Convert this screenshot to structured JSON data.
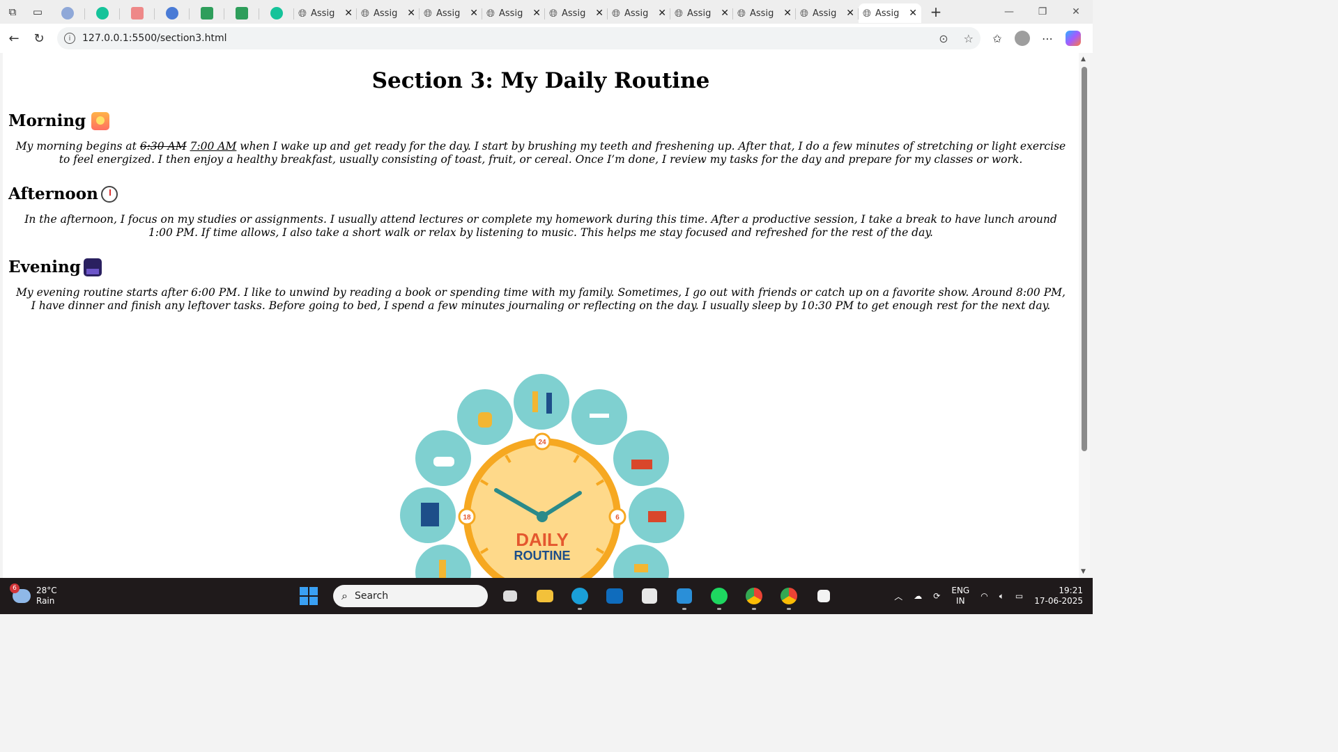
{
  "browser": {
    "tabs": [
      {
        "label": "Assig"
      },
      {
        "label": "Assig"
      },
      {
        "label": "Assig"
      },
      {
        "label": "Assig"
      },
      {
        "label": "Assig"
      },
      {
        "label": "Assig"
      },
      {
        "label": "Assig"
      },
      {
        "label": "Assig"
      },
      {
        "label": "Assig"
      },
      {
        "label": "Assig"
      }
    ],
    "url": "127.0.0.1:5500/section3.html"
  },
  "page": {
    "title": "Section 3: My Daily Routine",
    "morning": {
      "heading": "Morning",
      "text_before": "My morning begins at ",
      "old_time": "6:30 AM",
      "new_time": "7:00 AM",
      "text_after": " when I wake up and get ready for the day. I start by brushing my teeth and freshening up. After that, I do a few minutes of stretching or light exercise to feel energized. I then enjoy a healthy breakfast, usually consisting of toast, fruit, or cereal. Once I’m done, I review my tasks for the day and prepare for my classes or work."
    },
    "afternoon": {
      "heading": "Afternoon",
      "text": "In the afternoon, I focus on my studies or assignments. I usually attend lectures or complete my homework during this time. After a productive session, I take a break to have lunch around 1:00 PM. If time allows, I also take a short walk or relax by listening to music. This helps me stay focused and refreshed for the rest of the day."
    },
    "evening": {
      "heading": "Evening",
      "text": "My evening routine starts after 6:00 PM. I like to unwind by reading a book or spending time with my family. Sometimes, I go out with friends or catch up on a favorite show. Around 8:00 PM, I have dinner and finish any leftover tasks. Before going to bed, I spend a few minutes journaling or reflecting on the day. I usually sleep by 10:30 PM to get enough rest for the next day."
    },
    "illustration": {
      "line1": "DAILY",
      "line2": "ROUTINE",
      "marks": [
        "24",
        "6",
        "18"
      ]
    }
  },
  "taskbar": {
    "weather_temp": "28°C",
    "weather_desc": "Rain",
    "weather_badge": "6",
    "search_placeholder": "Search",
    "lang1": "ENG",
    "lang2": "IN",
    "time": "19:21",
    "date": "17-06-2025"
  },
  "colors": {
    "clock_face": "#fed98a",
    "clock_ring": "#f6a821",
    "routine_text": "#1d4e89",
    "daily_text": "#e4572e",
    "circle_bg": "#7fd0d0"
  }
}
